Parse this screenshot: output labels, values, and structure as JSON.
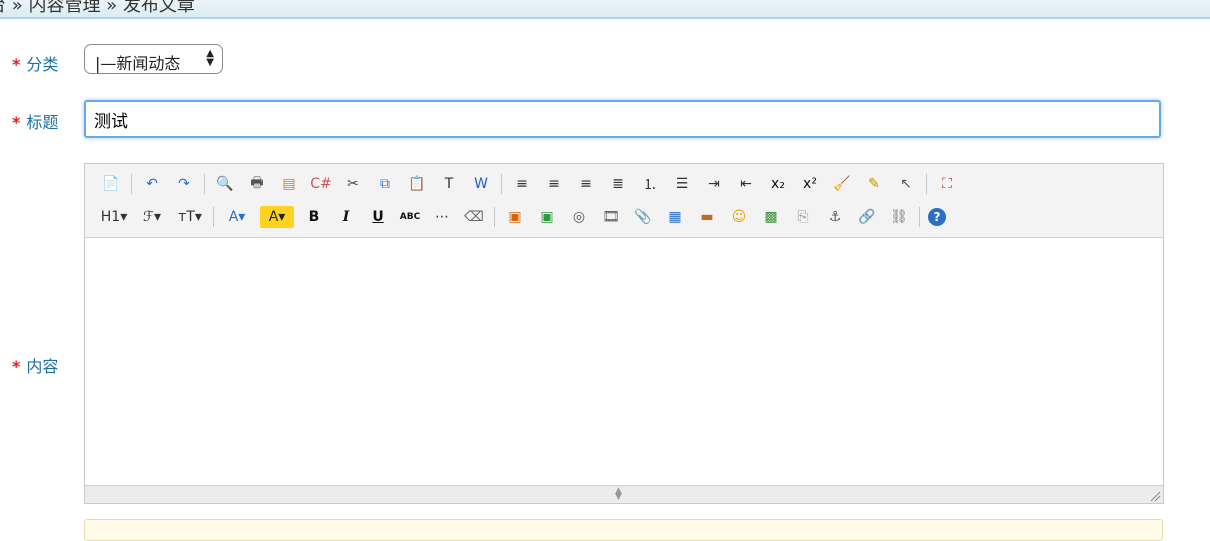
{
  "breadcrumb": "台 » 内容管理 » 发布文章",
  "form": {
    "required_mark": "*",
    "category_label": "分类",
    "category_value": "|—新闻动态",
    "title_label": "标题",
    "title_value": "测试",
    "content_label": "内容"
  },
  "toolbar": {
    "row1": [
      {
        "name": "source-code-icon",
        "glyph": "📄",
        "color": "#555"
      },
      {
        "sep": true
      },
      {
        "name": "undo-icon",
        "glyph": "↶",
        "color": "#2a6fc9"
      },
      {
        "name": "redo-icon",
        "glyph": "↷",
        "color": "#2a6fc9"
      },
      {
        "sep": true
      },
      {
        "name": "preview-icon",
        "glyph": "🔍",
        "color": "#666"
      },
      {
        "name": "print-icon",
        "glyph": "🖶",
        "color": "#555"
      },
      {
        "name": "template-icon",
        "glyph": "▤",
        "color": "#c98a1e"
      },
      {
        "name": "code-icon",
        "glyph": "C#",
        "color": "#c55"
      },
      {
        "name": "cut-icon",
        "glyph": "✂",
        "color": "#444"
      },
      {
        "name": "copy-icon",
        "glyph": "⧉",
        "color": "#3a7bd5"
      },
      {
        "name": "paste-icon",
        "glyph": "📋",
        "color": "#b07a2a"
      },
      {
        "name": "paste-text-icon",
        "glyph": "T",
        "color": "#333"
      },
      {
        "name": "paste-word-icon",
        "glyph": "W",
        "color": "#2a5ac9"
      },
      {
        "sep": true
      },
      {
        "name": "align-left-icon",
        "glyph": "≡",
        "color": "#333"
      },
      {
        "name": "align-center-icon",
        "glyph": "≡",
        "color": "#333"
      },
      {
        "name": "align-right-icon",
        "glyph": "≡",
        "color": "#333"
      },
      {
        "name": "align-justify-icon",
        "glyph": "≣",
        "color": "#333"
      },
      {
        "name": "ordered-list-icon",
        "glyph": "⒈",
        "color": "#333"
      },
      {
        "name": "unordered-list-icon",
        "glyph": "☰",
        "color": "#333"
      },
      {
        "name": "indent-icon",
        "glyph": "⇥",
        "color": "#333"
      },
      {
        "name": "outdent-icon",
        "glyph": "⇤",
        "color": "#333"
      },
      {
        "name": "subscript-icon",
        "glyph": "x₂",
        "color": "#111"
      },
      {
        "name": "superscript-icon",
        "glyph": "x²",
        "color": "#111"
      },
      {
        "name": "clear-format-icon",
        "glyph": "🧹",
        "color": "#d9a000"
      },
      {
        "name": "quick-format-icon",
        "glyph": "✎",
        "color": "#c88a00"
      },
      {
        "name": "select-all-icon",
        "glyph": "↖",
        "color": "#555"
      },
      {
        "sep": true
      },
      {
        "name": "fullscreen-icon",
        "glyph": "⛶",
        "color": "#c33"
      }
    ],
    "row2": [
      {
        "name": "heading-icon",
        "glyph": "H1▾",
        "color": "#333",
        "wide": true
      },
      {
        "name": "font-family-icon",
        "glyph": "ℱ▾",
        "color": "#333",
        "wide": true
      },
      {
        "name": "font-size-icon",
        "glyph": "ᴛT▾",
        "color": "#333",
        "wide": true
      },
      {
        "sep": true
      },
      {
        "name": "font-color-icon",
        "glyph": "A▾",
        "color": "#2a6fc9",
        "wide": true
      },
      {
        "name": "highlight-color-icon",
        "glyph": "A▾",
        "color": "#222",
        "bg": "#ffd21f",
        "wide": true
      },
      {
        "name": "bold-icon",
        "glyph": "B",
        "color": "#111",
        "bold": true
      },
      {
        "name": "italic-icon",
        "glyph": "I",
        "color": "#111",
        "italic": true
      },
      {
        "name": "underline-icon",
        "glyph": "U",
        "color": "#111",
        "underline": true
      },
      {
        "name": "strikethrough-icon",
        "glyph": "ABC",
        "color": "#111",
        "small": true
      },
      {
        "name": "horizontal-rule-icon",
        "glyph": "⋯",
        "color": "#333"
      },
      {
        "name": "eraser-icon",
        "glyph": "⌫",
        "color": "#666"
      },
      {
        "sep": true
      },
      {
        "name": "image-icon",
        "glyph": "▣",
        "color": "#d4650a"
      },
      {
        "name": "multi-image-icon",
        "glyph": "▣",
        "color": "#2f9a3a"
      },
      {
        "name": "flash-icon",
        "glyph": "◎",
        "color": "#555"
      },
      {
        "name": "media-icon",
        "glyph": "🎞",
        "color": "#555"
      },
      {
        "name": "attachment-icon",
        "glyph": "📎",
        "color": "#555"
      },
      {
        "name": "table-icon",
        "glyph": "▦",
        "color": "#2a6fc9"
      },
      {
        "name": "insert-row-icon",
        "glyph": "▬",
        "color": "#c26a1e"
      },
      {
        "name": "emoticon-icon",
        "glyph": "☺",
        "color": "#e8a300"
      },
      {
        "name": "map-icon",
        "glyph": "▩",
        "color": "#3a8f3a"
      },
      {
        "name": "pagebreak-icon",
        "glyph": "⎘",
        "color": "#999"
      },
      {
        "name": "anchor-icon",
        "glyph": "⚓",
        "color": "#555"
      },
      {
        "name": "link-icon",
        "glyph": "🔗",
        "color": "#555"
      },
      {
        "name": "unlink-icon",
        "glyph": "⛓",
        "color": "#777"
      },
      {
        "sep": true
      },
      {
        "name": "help-icon",
        "glyph": "?",
        "color": "#fff",
        "circle": "#2a6fc9"
      }
    ]
  }
}
